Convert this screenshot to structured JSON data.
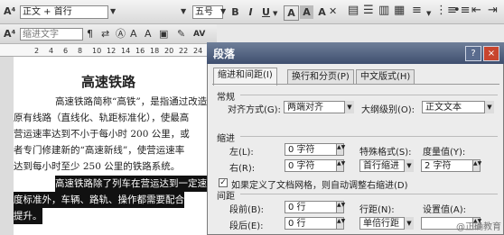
{
  "toolbar1": {
    "style_value": "正文 + 首行",
    "size_value": "五号",
    "bold": "B",
    "italic": "I",
    "underline": "U",
    "font_color_a": "A",
    "char_shade_a": "A",
    "text_effect_a": "A"
  },
  "toolbar2": {
    "border_value": "缩进文字",
    "char_spacing": "AV"
  },
  "ruler": {
    "ticks": [
      "2",
      "4",
      "6",
      "8",
      "10",
      "12",
      "14",
      "16",
      "18",
      "20",
      "22",
      "24"
    ]
  },
  "document": {
    "title": "高速铁路",
    "paragraph1": [
      "高速铁路简称“高铁”，是指通过改造",
      "原有线路（直线化、轨距标准化），使最高",
      "营运速率达到不小于每小时 200 公里，或",
      "者专门修建新的“高速新线”，使营运速率",
      "达到每小时至少 250 公里的铁路系统。"
    ],
    "paragraph2_selected": [
      "高速铁路除了列车在营运达到一定速",
      "度标准外，车辆、路轨、操作都需要配合",
      "提升。"
    ]
  },
  "dialog": {
    "title": "段落",
    "help": "?",
    "close": "×",
    "tabs": [
      "缩进和间距(I)",
      "换行和分页(P)",
      "中文版式(H)"
    ],
    "general_label": "常规",
    "alignment_label": "对齐方式(G):",
    "alignment_value": "两端对齐",
    "outline_label": "大纲级别(O):",
    "outline_value": "正文文本",
    "indent_label": "缩进",
    "left_label": "左(L):",
    "left_value": "0 字符",
    "right_label": "右(R):",
    "right_value": "0 字符",
    "special_label": "特殊格式(S):",
    "special_value": "首行缩进",
    "by_label": "度量值(Y):",
    "by_value": "2 字符",
    "grid_checkbox": "如果定义了文档网格，则自动调整右缩进(D)",
    "spacing_label": "间距",
    "before_label": "段前(B):",
    "before_value": "0 行",
    "after_label": "段后(E):",
    "after_value": "0 行",
    "line_label": "行距(N):",
    "line_value": "单倍行距",
    "at_label": "设置值(A):",
    "at_value": ""
  },
  "watermark": "@正确教育"
}
